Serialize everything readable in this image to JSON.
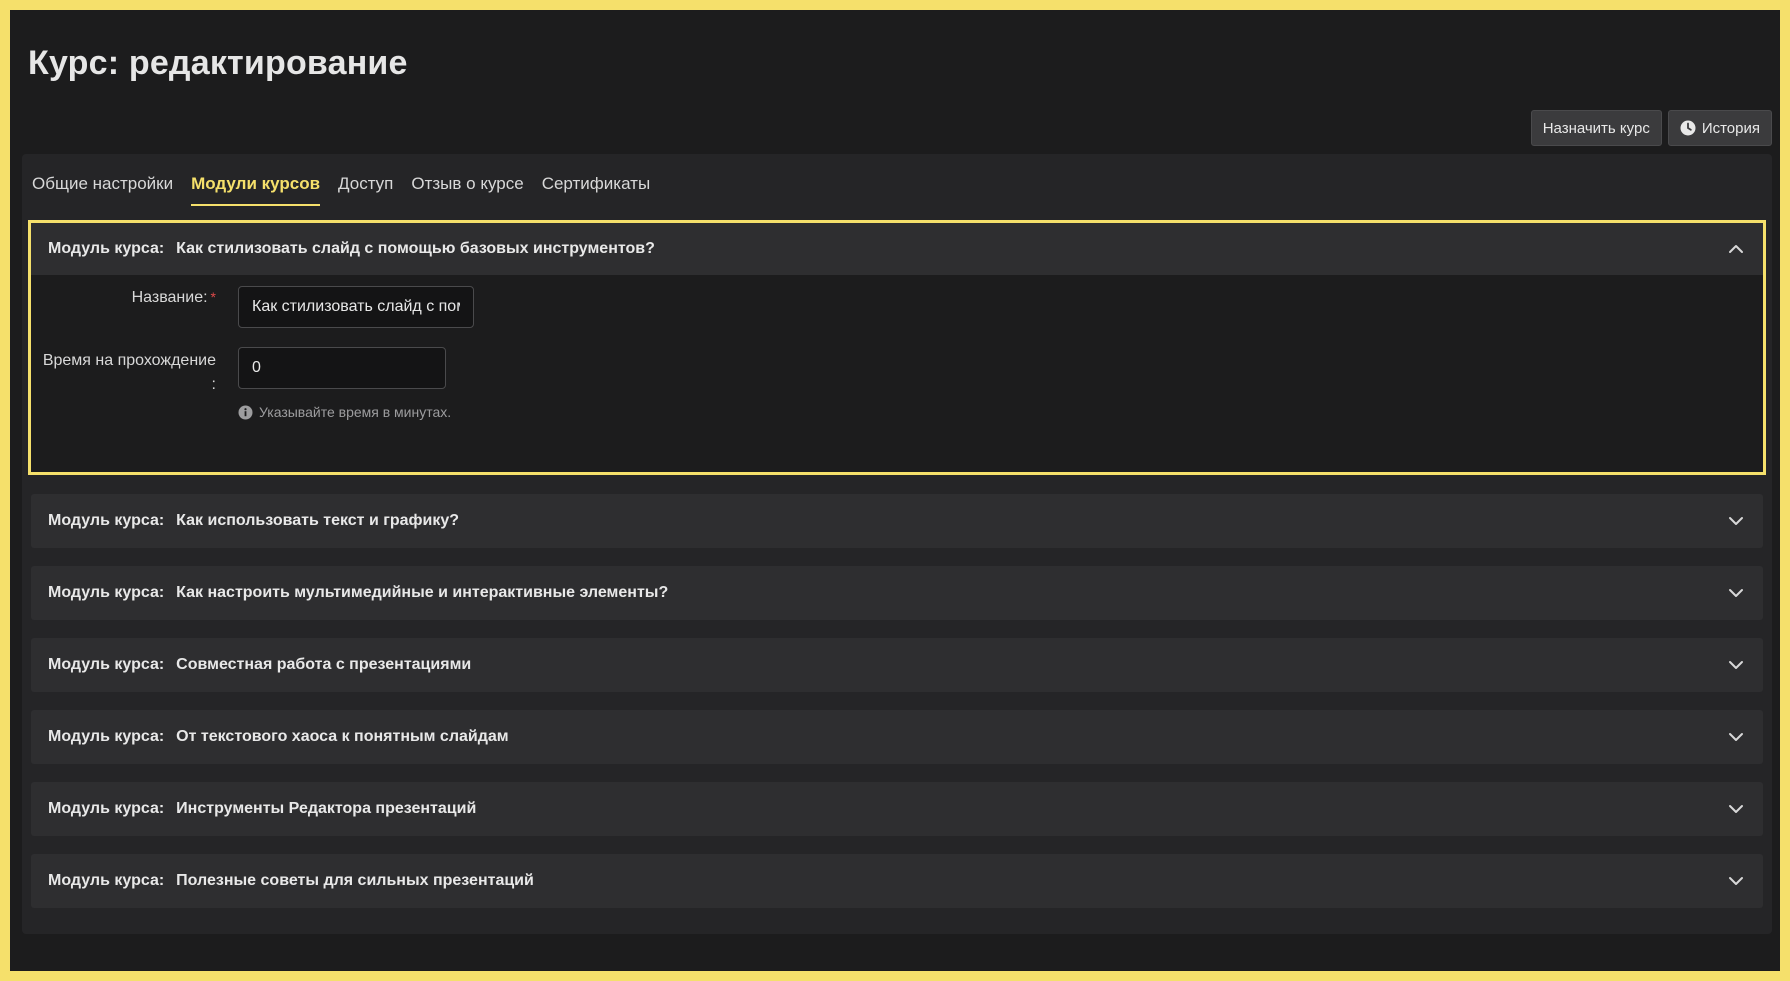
{
  "page": {
    "title": "Курс: редактирование"
  },
  "actions": {
    "assign_label": "Назначить курс",
    "history_label": "История"
  },
  "tabs": [
    {
      "label": "Общие настройки",
      "active": false
    },
    {
      "label": "Модули курсов",
      "active": true
    },
    {
      "label": "Доступ",
      "active": false
    },
    {
      "label": "Отзыв о курсе",
      "active": false
    },
    {
      "label": "Сертификаты",
      "active": false
    }
  ],
  "module_prefix": "Модуль курса:",
  "expanded_module": {
    "title": "Как стилизовать слайд с помощью базовых инструментов?",
    "name_label": "Название:",
    "name_value": "Как стилизовать слайд с пом",
    "time_label_line1": "Время на прохождение",
    "time_label_line2": ":",
    "time_value": "0",
    "hint": "Указывайте время в минутах."
  },
  "modules": [
    {
      "title": "Как использовать текст и графику?"
    },
    {
      "title": "Как настроить мультимедийные и интерактивные элементы?"
    },
    {
      "title": "Совместная работа с презентациями"
    },
    {
      "title": "От текстового хаоса к понятным слайдам"
    },
    {
      "title": "Инструменты Редактора презентаций"
    },
    {
      "title": "Полезные советы для сильных презентаций"
    }
  ],
  "colors": {
    "accent": "#f5e06b",
    "background": "#1c1c1d",
    "panel": "#252527",
    "header": "#2e2e30",
    "required": "#e04a4a"
  },
  "icons": {
    "history": "clock-icon",
    "collapse": "chevron-up-icon",
    "expand": "chevron-down-icon",
    "hint": "info-icon"
  }
}
